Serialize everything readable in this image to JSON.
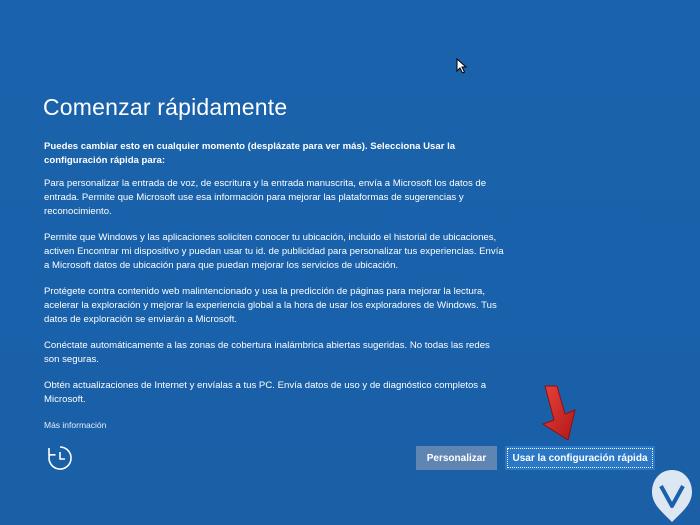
{
  "setup": {
    "title": "Comenzar rápidamente",
    "intro": "Puedes cambiar esto en cualquier momento (desplázate para ver más). Selecciona Usar la configuración rápida para:",
    "paragraphs": [
      "Para personalizar la entrada de voz, de escritura y la entrada manuscrita, envía a Microsoft los datos de entrada. Permite que Microsoft use esa información para mejorar las plataformas de sugerencias y reconocimiento.",
      "Permite que Windows y las aplicaciones soliciten conocer tu ubicación, incluido el historial de ubicaciones, activen Encontrar mi dispositivo y puedan usar tu id. de publicidad para personalizar tus experiencias. Envía a Microsoft datos de ubicación para que puedan mejorar los servicios de ubicación.",
      "Protégete contra contenido web malintencionado y usa la predicción de páginas para mejorar la lectura, acelerar la exploración y mejorar la experiencia global a la hora de usar los exploradores de Windows. Tus datos de exploración se enviarán a Microsoft.",
      "Conéctate automáticamente a las zonas de cobertura inalámbrica abiertas sugeridas. No todas las redes son seguras.",
      "Obtén actualizaciones de Internet y envíalas a tus PC. Envía datos de uso y de diagnóstico completos a Microsoft."
    ],
    "more_info": "Más información",
    "customize_label": "Personalizar",
    "express_label": "Usar la configuración rápida"
  },
  "colors": {
    "background": "#1961aa",
    "button_secondary": "#5f86b3",
    "button_primary": "#2b78c6",
    "arrow": "#d42a2a"
  },
  "icons": {
    "accessibility": "ease-of-access-icon",
    "cursor": "mouse-pointer-icon",
    "arrow": "red-down-arrow-icon",
    "watermark": "logo-watermark-icon"
  }
}
